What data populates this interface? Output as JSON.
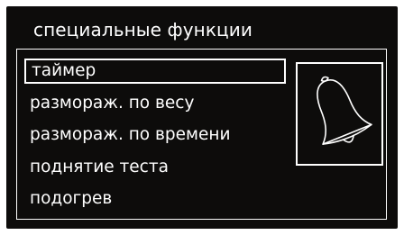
{
  "screen": {
    "title": "специальные функции"
  },
  "menu": {
    "items": [
      {
        "label": "таймер",
        "selected": true
      },
      {
        "label": "размораж. по весу",
        "selected": false
      },
      {
        "label": "размораж. по времени",
        "selected": false
      },
      {
        "label": "поднятие теста",
        "selected": false
      },
      {
        "label": "подогрев",
        "selected": false
      }
    ]
  },
  "preview": {
    "icon": "bell-icon"
  },
  "colors": {
    "background": "#0d0c0b",
    "foreground": "#ffffff"
  }
}
